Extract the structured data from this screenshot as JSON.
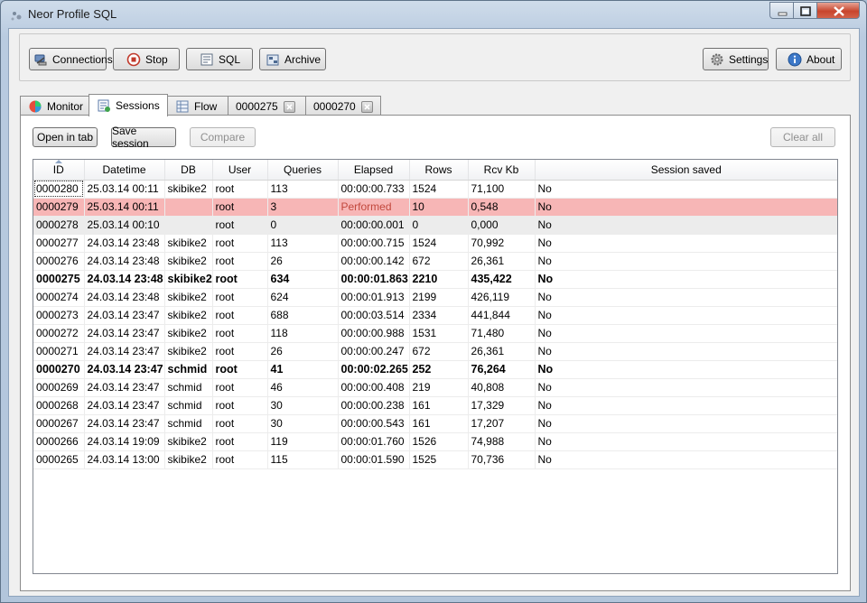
{
  "window": {
    "title": "Neor Profile SQL"
  },
  "toolbar": {
    "connections_label": "Connections",
    "stop_label": "Stop",
    "sql_label": "SQL",
    "archive_label": "Archive",
    "settings_label": "Settings",
    "about_label": "About"
  },
  "tabs": [
    {
      "label": "Monitor",
      "icon": "monitor-icon"
    },
    {
      "label": "Sessions",
      "icon": "sessions-icon",
      "active": true
    },
    {
      "label": "Flow",
      "icon": "flow-icon"
    },
    {
      "label": "0000275",
      "closable": true
    },
    {
      "label": "0000270",
      "closable": true
    }
  ],
  "sessions": {
    "open_in_tab_label": "Open in tab",
    "save_session_label": "Save session",
    "compare_label": "Compare",
    "clear_all_label": "Clear all",
    "columns": [
      "ID",
      "Datetime",
      "DB",
      "User",
      "Queries",
      "Elapsed",
      "Rows",
      "Rcv Kb",
      "Session saved"
    ],
    "rows": [
      {
        "id": "0000280",
        "datetime": "25.03.14 00:11",
        "db": "skibike2",
        "user": "root",
        "queries": "113",
        "elapsed": "00:00:00.733",
        "rows": "1524",
        "rcv": "71,100",
        "saved": "No",
        "style": ""
      },
      {
        "id": "0000279",
        "datetime": "25.03.14 00:11",
        "db": "",
        "user": "root",
        "queries": "3",
        "elapsed": "Performed",
        "rows": "10",
        "rcv": "0,548",
        "saved": "No",
        "style": "err"
      },
      {
        "id": "0000278",
        "datetime": "25.03.14 00:10",
        "db": "",
        "user": "root",
        "queries": "0",
        "elapsed": "00:00:00.001",
        "rows": "0",
        "rcv": "0,000",
        "saved": "No",
        "style": "sel"
      },
      {
        "id": "0000277",
        "datetime": "24.03.14 23:48",
        "db": "skibike2",
        "user": "root",
        "queries": "113",
        "elapsed": "00:00:00.715",
        "rows": "1524",
        "rcv": "70,992",
        "saved": "No",
        "style": ""
      },
      {
        "id": "0000276",
        "datetime": "24.03.14 23:48",
        "db": "skibike2",
        "user": "root",
        "queries": "26",
        "elapsed": "00:00:00.142",
        "rows": "672",
        "rcv": "26,361",
        "saved": "No",
        "style": ""
      },
      {
        "id": "0000275",
        "datetime": "24.03.14 23:48",
        "db": "skibike2",
        "user": "root",
        "queries": "634",
        "elapsed": "00:00:01.863",
        "rows": "2210",
        "rcv": "435,422",
        "saved": "No",
        "style": "bold"
      },
      {
        "id": "0000274",
        "datetime": "24.03.14 23:48",
        "db": "skibike2",
        "user": "root",
        "queries": "624",
        "elapsed": "00:00:01.913",
        "rows": "2199",
        "rcv": "426,119",
        "saved": "No",
        "style": ""
      },
      {
        "id": "0000273",
        "datetime": "24.03.14 23:47",
        "db": "skibike2",
        "user": "root",
        "queries": "688",
        "elapsed": "00:00:03.514",
        "rows": "2334",
        "rcv": "441,844",
        "saved": "No",
        "style": ""
      },
      {
        "id": "0000272",
        "datetime": "24.03.14 23:47",
        "db": "skibike2",
        "user": "root",
        "queries": "118",
        "elapsed": "00:00:00.988",
        "rows": "1531",
        "rcv": "71,480",
        "saved": "No",
        "style": ""
      },
      {
        "id": "0000271",
        "datetime": "24.03.14 23:47",
        "db": "skibike2",
        "user": "root",
        "queries": "26",
        "elapsed": "00:00:00.247",
        "rows": "672",
        "rcv": "26,361",
        "saved": "No",
        "style": ""
      },
      {
        "id": "0000270",
        "datetime": "24.03.14 23:47",
        "db": "schmid",
        "user": "root",
        "queries": "41",
        "elapsed": "00:00:02.265",
        "rows": "252",
        "rcv": "76,264",
        "saved": "No",
        "style": "bold"
      },
      {
        "id": "0000269",
        "datetime": "24.03.14 23:47",
        "db": "schmid",
        "user": "root",
        "queries": "46",
        "elapsed": "00:00:00.408",
        "rows": "219",
        "rcv": "40,808",
        "saved": "No",
        "style": ""
      },
      {
        "id": "0000268",
        "datetime": "24.03.14 23:47",
        "db": "schmid",
        "user": "root",
        "queries": "30",
        "elapsed": "00:00:00.238",
        "rows": "161",
        "rcv": "17,329",
        "saved": "No",
        "style": ""
      },
      {
        "id": "0000267",
        "datetime": "24.03.14 23:47",
        "db": "schmid",
        "user": "root",
        "queries": "30",
        "elapsed": "00:00:00.543",
        "rows": "161",
        "rcv": "17,207",
        "saved": "No",
        "style": ""
      },
      {
        "id": "0000266",
        "datetime": "24.03.14 19:09",
        "db": "skibike2",
        "user": "root",
        "queries": "119",
        "elapsed": "00:00:01.760",
        "rows": "1526",
        "rcv": "74,988",
        "saved": "No",
        "style": ""
      },
      {
        "id": "0000265",
        "datetime": "24.03.14 13:00",
        "db": "skibike2",
        "user": "root",
        "queries": "115",
        "elapsed": "00:00:01.590",
        "rows": "1525",
        "rcv": "70,736",
        "saved": "No",
        "style": ""
      }
    ]
  }
}
